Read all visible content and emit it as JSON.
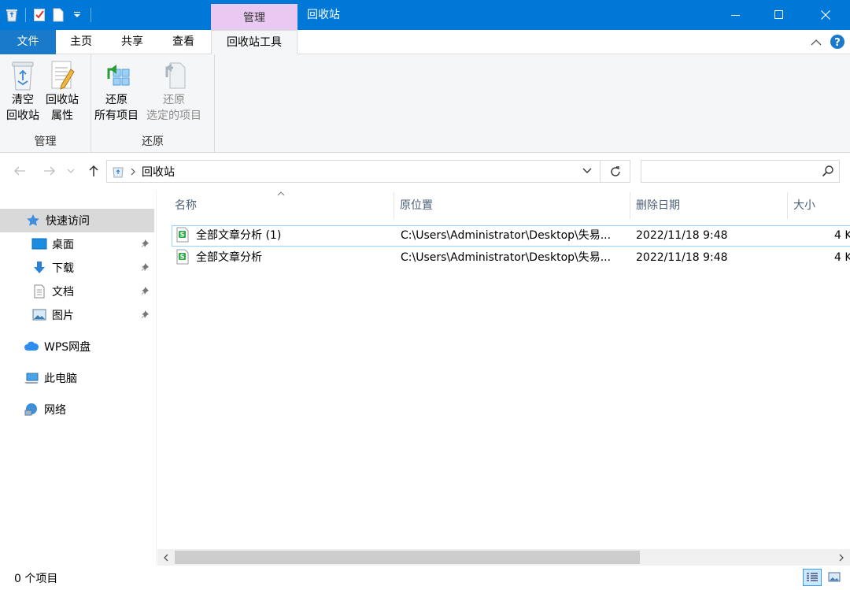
{
  "titlebar": {
    "context_tab": "管理",
    "title": "回收站"
  },
  "tabs": {
    "file": "文件",
    "home": "主页",
    "share": "共享",
    "view": "查看",
    "tool": "回收站工具"
  },
  "ribbon": {
    "manage_group": "管理",
    "restore_group": "还原",
    "empty": [
      "清空",
      "回收站"
    ],
    "properties": [
      "回收站",
      "属性"
    ],
    "restore_all": [
      "还原",
      "所有项目"
    ],
    "restore_selected": [
      "还原",
      "选定的项目"
    ]
  },
  "address": {
    "path": "回收站"
  },
  "nav": {
    "quick_access": "快速访问",
    "desktop": "桌面",
    "downloads": "下载",
    "documents": "文档",
    "pictures": "图片",
    "wps": "WPS网盘",
    "this_pc": "此电脑",
    "network": "网络"
  },
  "columns": {
    "name": "名称",
    "location": "原位置",
    "date": "删除日期",
    "size": "大小"
  },
  "files": [
    {
      "name": "全部文章分析 (1)",
      "location": "C:\\Users\\Administrator\\Desktop\\失易...",
      "date": "2022/11/18 9:48",
      "size": "4 K"
    },
    {
      "name": "全部文章分析",
      "location": "C:\\Users\\Administrator\\Desktop\\失易...",
      "date": "2022/11/18 9:48",
      "size": "4 K"
    }
  ],
  "status": {
    "count": "0 个项目"
  },
  "colors": {
    "titlebar": "#0078d7",
    "context_tab": "#e9c9f2",
    "file_tab": "#1979ca",
    "selection": "#99d1ff"
  }
}
